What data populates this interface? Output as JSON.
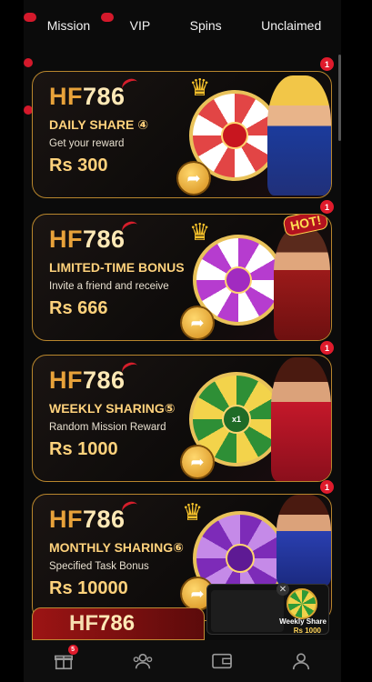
{
  "tabs": [
    "Mission",
    "VIP",
    "Spins",
    "Unclaimed"
  ],
  "brand": {
    "hf": "HF",
    "num": "786"
  },
  "cards": [
    {
      "title": "DAILY SHARE ④",
      "subtitle": "Get your reward",
      "price": "Rs 300",
      "badge": "1"
    },
    {
      "title": "LIMITED-TIME BONUS",
      "subtitle": "Invite a friend and receive",
      "price": "Rs 666",
      "badge": "1",
      "hot": "HOT!"
    },
    {
      "title": "WEEKLY SHARING⑤",
      "subtitle": "Random Mission Reward",
      "price": "Rs 1000",
      "badge": "1",
      "wheel_center": "x1"
    },
    {
      "title": "MONTHLY SHARING⑥",
      "subtitle": "Specified Task Bonus",
      "price": "Rs 10000",
      "badge": "1"
    }
  ],
  "promo": {
    "title": "Weekly Share",
    "price": "Rs 1000",
    "close": "✕"
  },
  "nav": {
    "gift_badge": "5"
  },
  "icons": {
    "action": "arrow-share-icon",
    "nav": [
      "gift-icon",
      "people-icon",
      "wallet-icon",
      "profile-icon"
    ]
  },
  "colors": {
    "accent_gold": "#ffd27c",
    "brand_orange": "#e8a23a",
    "badge_red": "#e01b2c",
    "card_border": "#b8862d"
  }
}
